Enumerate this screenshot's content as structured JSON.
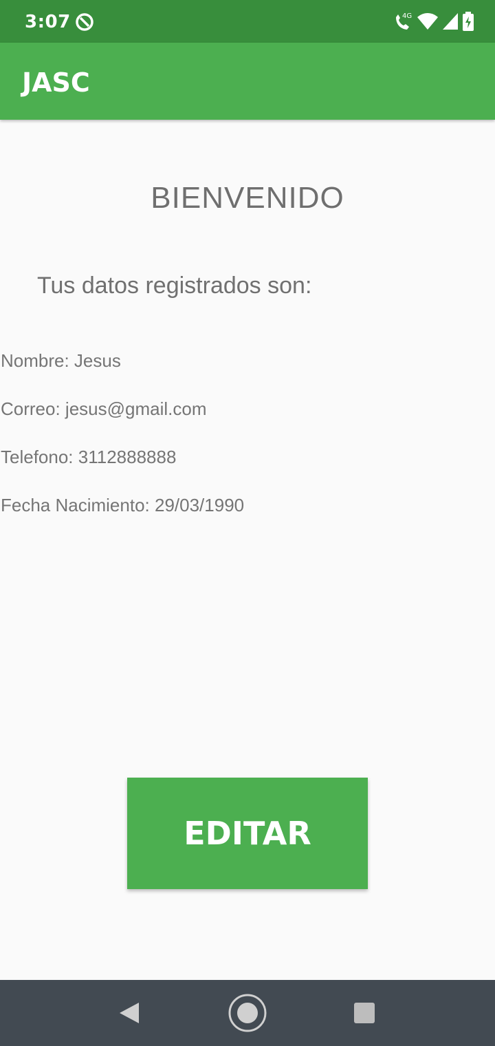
{
  "status": {
    "time": "3:07",
    "network": "4G"
  },
  "appbar": {
    "title": "JASC"
  },
  "main": {
    "heading": "BIENVENIDO",
    "subtitle": "Tus datos registrados son:",
    "fields": [
      {
        "text": "Nombre: Jesus"
      },
      {
        "text": "Correo: jesus@gmail.com"
      },
      {
        "text": "Telefono: 3112888888"
      },
      {
        "text": "Fecha Nacimiento: 29/03/1990"
      }
    ],
    "edit_button": "EDITAR"
  },
  "icons": {
    "dnd": "do-not-disturb-icon",
    "wifi_call": "wifi-calling-icon",
    "wifi": "wifi-icon",
    "signal": "signal-icon",
    "battery": "battery-charging-icon",
    "back": "back-icon",
    "home": "home-icon",
    "recents": "recents-icon"
  },
  "colors": {
    "status_bar": "#388e3c",
    "primary": "#4caf50",
    "nav_bar": "#424a52"
  }
}
